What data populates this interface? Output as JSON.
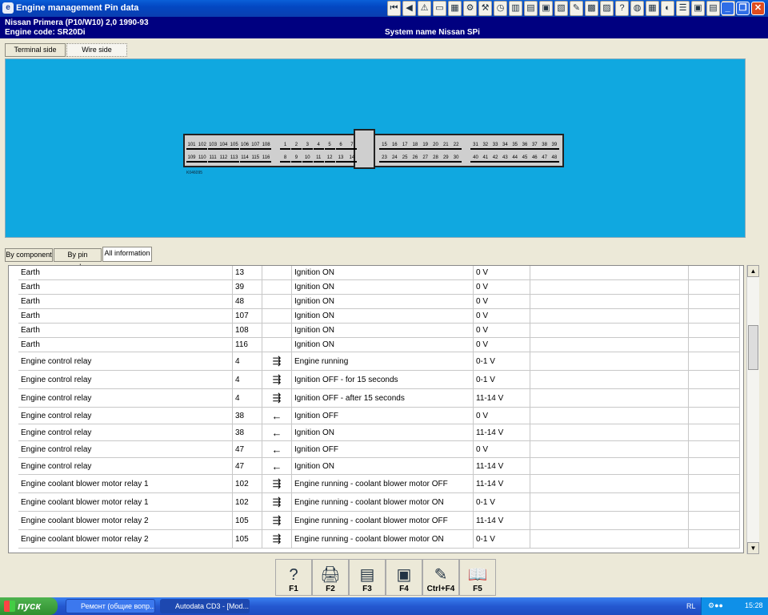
{
  "window": {
    "title": "Engine management Pin data"
  },
  "toolbar": {
    "icons": [
      "first-icon",
      "prev-icon",
      "warning-icon",
      "blank-icon",
      "monitor-icon",
      "gear-icon",
      "tools-icon",
      "clock-icon",
      "chart-icon",
      "doc-icon",
      "save-icon",
      "print-icon",
      "pen-icon",
      "car-icon",
      "book-icon",
      "help-icon",
      "globe-icon",
      "photo-icon",
      "dial-icon",
      "list-icon",
      "engine-icon",
      "camera-icon",
      "info-icon"
    ]
  },
  "info": {
    "line1": "Nissan   Primera (P10/W10) 2,0  1990-93",
    "line2": "Engine code: SR20Di",
    "system": "System name Nissan SPi"
  },
  "side_tabs": [
    "Terminal side",
    "Wire side"
  ],
  "connector": {
    "left_top": [
      "101",
      "102",
      "103",
      "104",
      "105",
      "106",
      "107",
      "108"
    ],
    "left_bottom": [
      "109",
      "110",
      "111",
      "112",
      "113",
      "114",
      "115",
      "116"
    ],
    "mid_top": [
      "1",
      "2",
      "3",
      "4",
      "5",
      "6",
      "7"
    ],
    "mid_bottom": [
      "8",
      "9",
      "10",
      "11",
      "12",
      "13",
      "14"
    ],
    "r1_top": [
      "15",
      "16",
      "17",
      "18",
      "19",
      "20",
      "21",
      "22"
    ],
    "r1_bottom": [
      "23",
      "24",
      "25",
      "26",
      "27",
      "28",
      "29",
      "30"
    ],
    "r2_top": [
      "31",
      "32",
      "33",
      "34",
      "35",
      "36",
      "37",
      "38",
      "39"
    ],
    "r2_bottom": [
      "40",
      "41",
      "42",
      "43",
      "44",
      "45",
      "46",
      "47",
      "48"
    ],
    "ref": "K046095"
  },
  "lower_tabs": [
    "By component",
    "By pin number",
    "All information"
  ],
  "rows": [
    {
      "component": "Earth",
      "pin": "13",
      "dir": "",
      "condition": "Ignition ON",
      "value": "0 V"
    },
    {
      "component": "Earth",
      "pin": "39",
      "dir": "",
      "condition": "Ignition ON",
      "value": "0 V"
    },
    {
      "component": "Earth",
      "pin": "48",
      "dir": "",
      "condition": "Ignition ON",
      "value": "0 V"
    },
    {
      "component": "Earth",
      "pin": "107",
      "dir": "",
      "condition": "Ignition ON",
      "value": "0 V"
    },
    {
      "component": "Earth",
      "pin": "108",
      "dir": "",
      "condition": "Ignition ON",
      "value": "0 V"
    },
    {
      "component": "Earth",
      "pin": "116",
      "dir": "",
      "condition": "Ignition ON",
      "value": "0 V"
    },
    {
      "component": "Engine control relay",
      "pin": "4",
      "dir": "⇶",
      "condition": "Engine running",
      "value": "0-1 V"
    },
    {
      "component": "Engine control relay",
      "pin": "4",
      "dir": "⇶",
      "condition": "Ignition OFF - for 15 seconds",
      "value": "0-1 V"
    },
    {
      "component": "Engine control relay",
      "pin": "4",
      "dir": "⇶",
      "condition": "Ignition OFF - after 15 seconds",
      "value": "11-14 V"
    },
    {
      "component": "Engine control relay",
      "pin": "38",
      "dir": "←",
      "condition": "Ignition OFF",
      "value": "0 V"
    },
    {
      "component": "Engine control relay",
      "pin": "38",
      "dir": "←",
      "condition": "Ignition ON",
      "value": "11-14 V"
    },
    {
      "component": "Engine control relay",
      "pin": "47",
      "dir": "←",
      "condition": "Ignition OFF",
      "value": "0 V"
    },
    {
      "component": "Engine control relay",
      "pin": "47",
      "dir": "←",
      "condition": "Ignition ON",
      "value": "11-14 V"
    },
    {
      "component": "Engine coolant blower motor relay 1",
      "pin": "102",
      "dir": "⇶",
      "condition": "Engine running - coolant blower motor OFF",
      "value": "11-14 V"
    },
    {
      "component": "Engine coolant blower motor relay 1",
      "pin": "102",
      "dir": "⇶",
      "condition": "Engine running - coolant blower motor ON",
      "value": "0-1 V"
    },
    {
      "component": "Engine coolant blower motor relay 2",
      "pin": "105",
      "dir": "⇶",
      "condition": "Engine running - coolant blower motor OFF",
      "value": "11-14 V"
    },
    {
      "component": "Engine coolant blower motor relay 2",
      "pin": "105",
      "dir": "⇶",
      "condition": "Engine running - coolant blower motor ON",
      "value": "0-1 V"
    }
  ],
  "fkeys": [
    {
      "label": "F1",
      "icon": "?"
    },
    {
      "label": "F2",
      "icon": "🖨"
    },
    {
      "label": "F3",
      "icon": "▤"
    },
    {
      "label": "F4",
      "icon": "▣"
    },
    {
      "label": "Ctrl+F4",
      "icon": "✎"
    },
    {
      "label": "F5",
      "icon": "📖"
    }
  ],
  "taskbar": {
    "start": "пуск",
    "tasks": [
      "Ремонт (общие вопр...",
      "Autodata CD3 - [Mod..."
    ],
    "lang": "RL",
    "clock": "15:28"
  }
}
